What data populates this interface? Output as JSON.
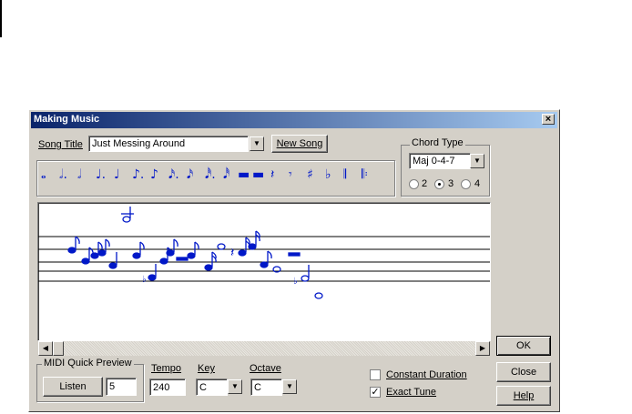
{
  "dialog": {
    "title": "Making Music",
    "close_glyph": "×"
  },
  "song": {
    "label": "Song Title",
    "value": "Just Messing Around",
    "new_song_label": "New Song"
  },
  "chord": {
    "group_title": "Chord Type",
    "selected": "Maj 0-4-7",
    "options": [
      "2",
      "3",
      "4"
    ],
    "selected_option": "3"
  },
  "palette": {
    "symbols": [
      "𝅝",
      "𝅗𝅥.",
      "𝅗𝅥",
      "♩.",
      "♩",
      "♪.",
      "♪",
      "𝅘𝅥𝅯.",
      "𝅘𝅥𝅯",
      "𝅘𝅥𝅰.",
      "𝅘𝅥𝅰",
      "▬",
      "▬",
      "𝄽",
      "𝄾",
      "♯",
      "♭",
      "𝄂",
      "𝄆"
    ]
  },
  "midi": {
    "group_title": "MIDI Quick Preview",
    "listen_label": "Listen",
    "count": "5"
  },
  "tempo": {
    "label": "Tempo",
    "value": "240"
  },
  "key": {
    "label": "Key",
    "value": "C"
  },
  "octave": {
    "label": "Octave",
    "value": "C"
  },
  "options": {
    "constant_duration": {
      "label": "Constant Duration",
      "checked": false
    },
    "exact_tune": {
      "label": "Exact Tune",
      "checked": true
    }
  },
  "buttons": {
    "ok": "OK",
    "close": "Close",
    "help": "Help"
  },
  "icons": {
    "dropdown": "dropdown-arrow-icon",
    "scroll_left": "scroll-left-icon",
    "scroll_right": "scroll-right-icon"
  },
  "colors": {
    "title_start": "#0a246a",
    "title_end": "#a6caf0",
    "note_color": "#0018c8",
    "face": "#d4d0c8"
  }
}
